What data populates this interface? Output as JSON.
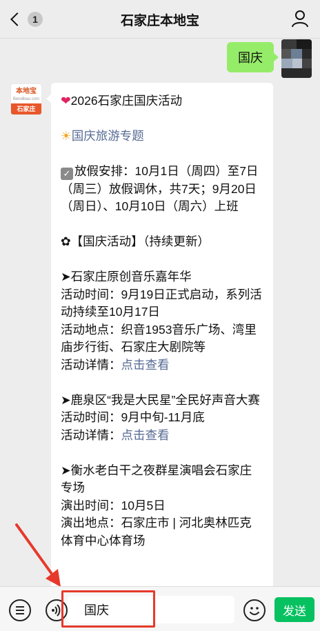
{
  "header": {
    "badge_count": "1",
    "title": "石家庄本地宝"
  },
  "chat": {
    "user_message": "国庆",
    "bot_avatar": {
      "logo_top": "本地宝",
      "logo_mid": "Bendibao.com",
      "logo_bottom": "石家庄"
    },
    "bot_message": {
      "heading": "2026石家庄国庆活动",
      "topic_link": "国庆旅游专题",
      "holiday_text": "放假安排：10月1日（周四）至7日（周三）放假调休，共7天；9月20日（周日）、10月10日（周六）上班",
      "section_title": "【国庆活动】（持续更新）",
      "events": [
        {
          "title": "➤石家庄原创音乐嘉年华",
          "time": "活动时间：9月19日正式启动，系列活动持续至10月17日",
          "place": "活动地点：织音1953音乐广场、湾里庙步行街、石家庄大剧院等",
          "detail_label": "活动详情：",
          "detail_link": "点击查看"
        },
        {
          "title": "➤鹿泉区“我是大民星”全民好声音大赛",
          "time": "活动时间：9月中旬-11月底",
          "detail_label": "活动详情：",
          "detail_link": "点击查看"
        },
        {
          "title": "➤衡水老白干之夜群星演唱会石家庄专场",
          "time": "演出时间：10月5日",
          "place": "演出地点：石家庄市 | 河北奥林匹克体育中心体育场"
        }
      ]
    }
  },
  "input_bar": {
    "text": "国庆",
    "send_label": "发送"
  },
  "icons": {
    "back": "chevron-left-icon",
    "profile": "person-icon",
    "menu": "menu-icon",
    "voice": "voice-icon",
    "emoji": "emoji-icon"
  }
}
